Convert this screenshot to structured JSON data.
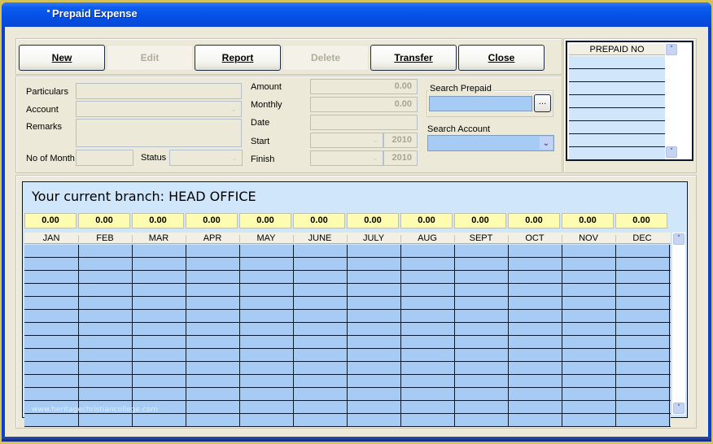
{
  "window": {
    "title": "Prepaid Expense"
  },
  "toolbar": {
    "buttons": [
      {
        "id": "new",
        "label": "New",
        "enabled": true
      },
      {
        "id": "edit",
        "label": "Edit",
        "enabled": false
      },
      {
        "id": "report",
        "label": "Report",
        "enabled": true
      },
      {
        "id": "delete",
        "label": "Delete",
        "enabled": false
      },
      {
        "id": "transfer",
        "label": "Transfer",
        "enabled": true
      },
      {
        "id": "close",
        "label": "Close",
        "enabled": true
      }
    ]
  },
  "form": {
    "particulars": {
      "label": "Particulars",
      "value": ""
    },
    "account": {
      "label": "Account",
      "value": ""
    },
    "remarks": {
      "label": "Remarks",
      "value": ""
    },
    "no_of_month": {
      "label": "No of Month",
      "value": ""
    },
    "status": {
      "label": "Status",
      "value": ""
    },
    "amount": {
      "label": "Amount",
      "value": "0.00"
    },
    "monthly": {
      "label": "Monthly",
      "value": "0.00"
    },
    "date": {
      "label": "Date",
      "value": ""
    },
    "start": {
      "label": "Start",
      "month": "",
      "year": "2010"
    },
    "finish": {
      "label": "Finish",
      "month": "",
      "year": "2010"
    },
    "search_prepaid": {
      "label": "Search Prepaid",
      "value": "",
      "browse_label": "..."
    },
    "search_account": {
      "label": "Search Account",
      "value": ""
    }
  },
  "prepaid_list": {
    "header": "PREPAID NO",
    "rows": [
      "",
      "",
      "",
      "",
      "",
      "",
      "",
      ""
    ]
  },
  "grid": {
    "branch_text": "Your current branch: HEAD OFFICE",
    "months": [
      "JAN",
      "FEB",
      "MAR",
      "APR",
      "MAY",
      "JUNE",
      "JULY",
      "AUG",
      "SEPT",
      "OCT",
      "NOV",
      "DEC"
    ],
    "totals": [
      "0.00",
      "0.00",
      "0.00",
      "0.00",
      "0.00",
      "0.00",
      "0.00",
      "0.00",
      "0.00",
      "0.00",
      "0.00",
      "0.00"
    ],
    "row_count": 14,
    "watermark": "www.heritagechristiancollege.com"
  },
  "colors": {
    "titlebar": "#0550e6",
    "grid_cell": "#a6ccf5",
    "totals_bg": "#fefcb0",
    "panel_bg": "#ece9d8"
  }
}
